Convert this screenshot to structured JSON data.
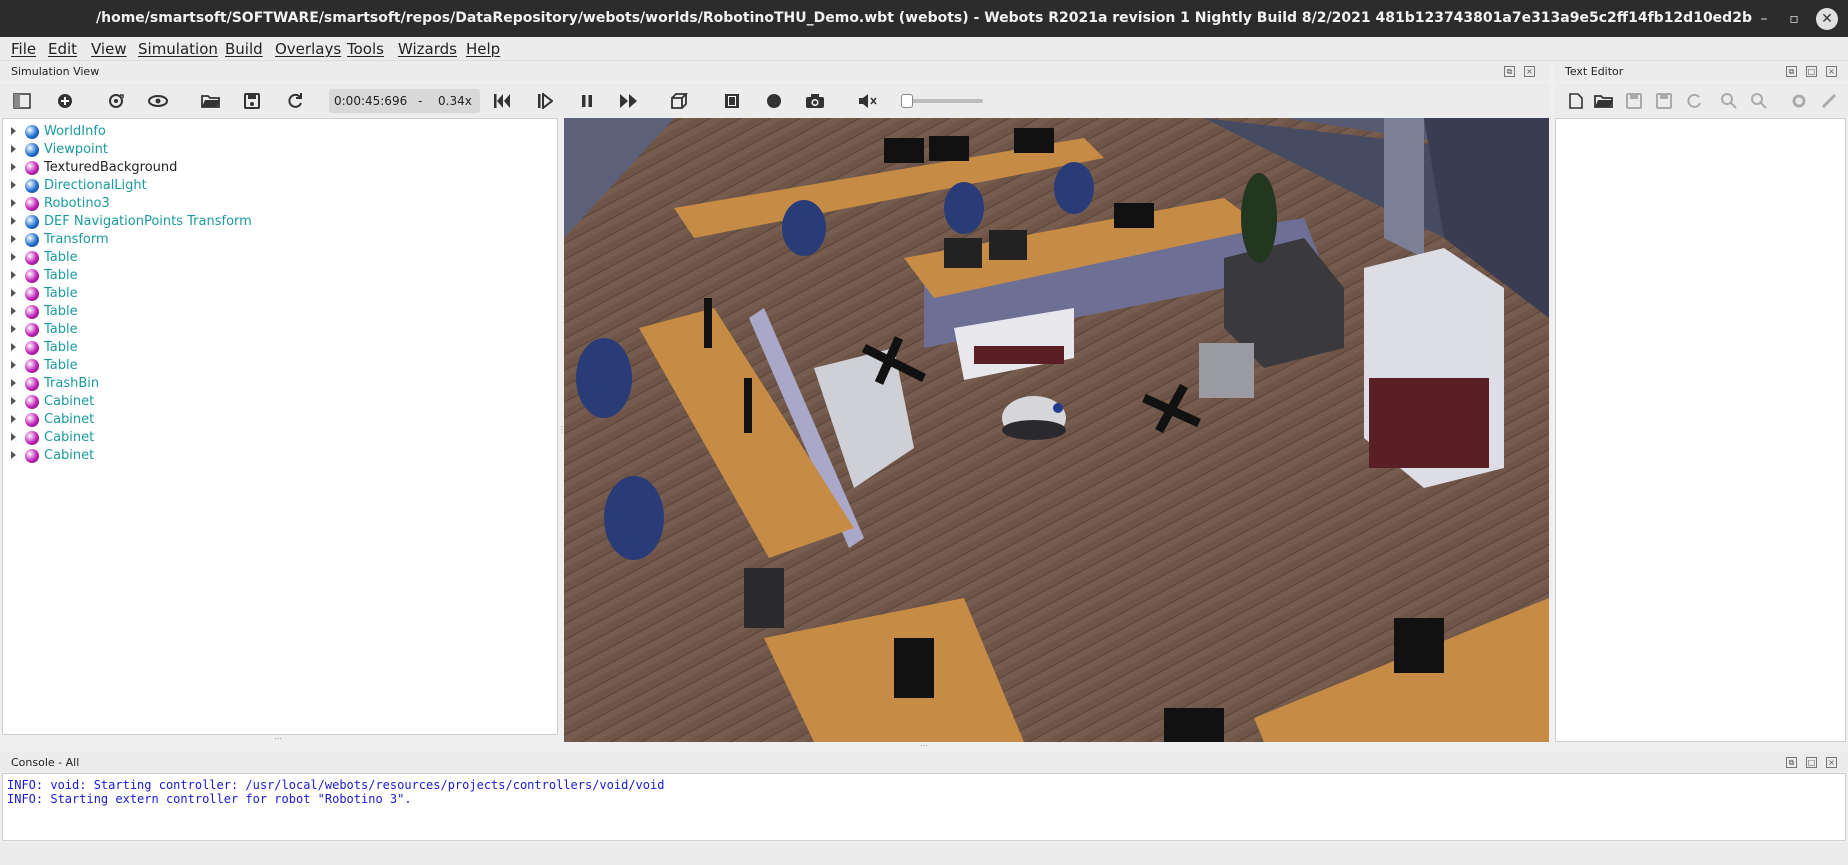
{
  "window": {
    "title": "/home/smartsoft/SOFTWARE/smartsoft/repos/DataRepository/webots/worlds/RobotinoTHU_Demo.wbt (webots) - Webots R2021a revision 1 Nightly Build 8/2/2021 481b123743801a7e313a9e5c2ff14fb12d10ed2b",
    "controls": {
      "minimize": "–",
      "restore": "▫",
      "close": "✕"
    }
  },
  "menu": [
    "File",
    "Edit",
    "View",
    "Simulation",
    "Build",
    "Overlays",
    "Tools",
    "Wizards",
    "Help"
  ],
  "simulation_view": {
    "label": "Simulation View"
  },
  "text_editor": {
    "label": "Text Editor"
  },
  "console": {
    "label": "Console - All",
    "lines": [
      "INFO: void: Starting controller: /usr/local/webots/resources/projects/controllers/void/void",
      "INFO: Starting extern controller for robot \"Robotino 3\"."
    ]
  },
  "toolbar": {
    "time": "0:00:45:696",
    "separator": "-",
    "speed": "0.34x",
    "volume_level": 0
  },
  "scene_tree": [
    {
      "name": "WorldInfo",
      "color": "#1e6fd0",
      "text_color": "#1a9aa0"
    },
    {
      "name": "Viewpoint",
      "color": "#1e6fd0",
      "text_color": "#1a9aa0"
    },
    {
      "name": "TexturedBackground",
      "color": "#c21fb8",
      "text_color": "#222222"
    },
    {
      "name": "DirectionalLight",
      "color": "#1e6fd0",
      "text_color": "#1a9aa0"
    },
    {
      "name": "Robotino3",
      "color": "#c21fb8",
      "text_color": "#1a9aa0"
    },
    {
      "name": "DEF NavigationPoints Transform",
      "color": "#1e6fd0",
      "text_color": "#1a9aa0"
    },
    {
      "name": "Transform",
      "color": "#1e6fd0",
      "text_color": "#1a9aa0"
    },
    {
      "name": "Table",
      "color": "#c21fb8",
      "text_color": "#1a9aa0"
    },
    {
      "name": "Table",
      "color": "#c21fb8",
      "text_color": "#1a9aa0"
    },
    {
      "name": "Table",
      "color": "#c21fb8",
      "text_color": "#1a9aa0"
    },
    {
      "name": "Table",
      "color": "#c21fb8",
      "text_color": "#1a9aa0"
    },
    {
      "name": "Table",
      "color": "#c21fb8",
      "text_color": "#1a9aa0"
    },
    {
      "name": "Table",
      "color": "#c21fb8",
      "text_color": "#1a9aa0"
    },
    {
      "name": "Table",
      "color": "#c21fb8",
      "text_color": "#1a9aa0"
    },
    {
      "name": "TrashBin",
      "color": "#c21fb8",
      "text_color": "#1a9aa0"
    },
    {
      "name": "Cabinet",
      "color": "#c21fb8",
      "text_color": "#1a9aa0"
    },
    {
      "name": "Cabinet",
      "color": "#c21fb8",
      "text_color": "#1a9aa0"
    },
    {
      "name": "Cabinet",
      "color": "#c21fb8",
      "text_color": "#1a9aa0"
    },
    {
      "name": "Cabinet",
      "color": "#c21fb8",
      "text_color": "#1a9aa0"
    }
  ],
  "icons": {
    "toggle_tree": "sidebar-toggle-icon",
    "add_node": "add-icon",
    "reset_view": "reset-viewpoint-icon",
    "show_all": "eye-icon",
    "open_world": "folder-open-icon",
    "save_world": "save-icon",
    "reload_world": "reload-icon",
    "reset_sim": "skip-back-icon",
    "step": "step-icon",
    "pause": "pause-icon",
    "fast": "fast-forward-icon",
    "rendering": "cube-icon",
    "movie": "film-icon",
    "record": "record-icon",
    "screenshot": "camera-icon",
    "mute": "speaker-mute-icon"
  }
}
